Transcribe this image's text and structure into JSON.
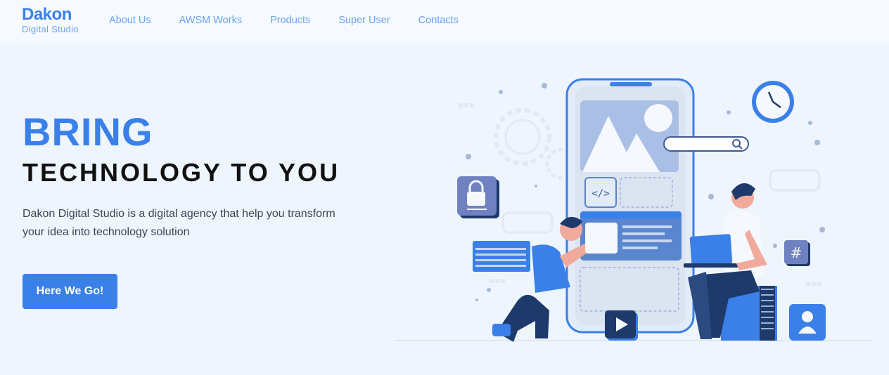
{
  "brand": {
    "name": "Dakon",
    "tagline": "Digital Studio"
  },
  "nav": {
    "items": [
      {
        "label": "About Us"
      },
      {
        "label": "AWSM Works"
      },
      {
        "label": "Products"
      },
      {
        "label": "Super User"
      },
      {
        "label": "Contacts"
      }
    ]
  },
  "hero": {
    "headline": "BRING",
    "subheadline": "TECHNOLOGY TO YOU",
    "description": "Dakon Digital Studio is a digital agency that help you transform your idea into technology solution",
    "cta_label": "Here We Go!"
  },
  "colors": {
    "accent": "#3a80e8",
    "nav_link": "#6aa3ef",
    "background": "#eef5fd",
    "navbar_bg": "#f6f9fd"
  }
}
